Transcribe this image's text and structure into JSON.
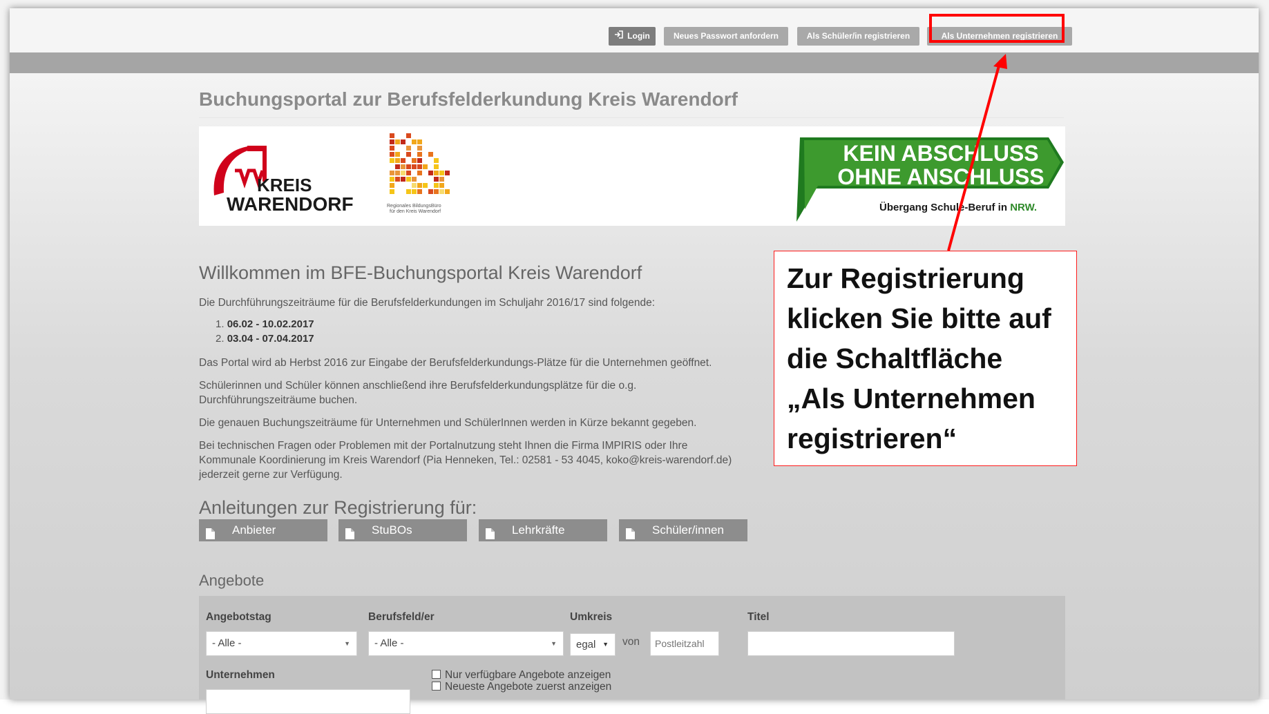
{
  "topbar": {
    "login_label": "Login",
    "password_label": "Neues Passwort anfordern",
    "student_register_label": "Als Schüler/in registrieren",
    "company_register_label": "Als Unternehmen registrieren"
  },
  "site_title": "Buchungsportal zur Berufsfelderkundung Kreis Warendorf",
  "banner": {
    "kreis_line1": "KREIS",
    "kreis_line2": "WARENDORF",
    "bb_line1": "Regionales BildungsBüro",
    "bb_line2": "für den Kreis Warendorf",
    "kaoa_line1": "KEIN ABSCHLUSS",
    "kaoa_line2": "OHNE ANSCHLUSS",
    "kaoa_sub_prefix": "Übergang Schule-Beruf in ",
    "kaoa_nrw": "NRW."
  },
  "welcome": {
    "heading": "Willkommen im BFE-Buchungsportal Kreis Warendorf",
    "intro": "Die Durchführungszeiträume für die Berufsfelderkundungen im Schuljahr 2016/17 sind folgende:",
    "periods": [
      {
        "num": "1.",
        "text": "06.02 - 10.02.2017"
      },
      {
        "num": "2.",
        "text": "03.04 - 07.04.2017"
      }
    ],
    "p1": "Das Portal wird ab Herbst 2016 zur Eingabe der Berufsfelderkundungs-Plätze für die Unternehmen geöffnet.",
    "p2a": "Schülerinnen und Schüler können anschließend ihre Berufsfelderkundungsplätze  für die o.g.",
    "p2b": "Durchführungszeiträume buchen.",
    "p3": "Die genauen Buchungszeiträume für Unternehmen und SchülerInnen werden in Kürze bekannt gegeben.",
    "p4a": "Bei technischen Fragen oder Problemen mit der Portalnutzung steht Ihnen die Firma IMPIRIS oder Ihre",
    "p4b": "Kommunale Koordinierung im Kreis Warendorf (Pia Henneken, Tel.: 02581 - 53 4045, koko@kreis-warendorf.de)",
    "p4c": "jederzeit gerne zur Verfügung."
  },
  "guides": {
    "heading": "Anleitungen zur Registrierung für:",
    "buttons": [
      "Anbieter",
      "StuBOs",
      "Lehrkräfte",
      "Schüler/innen"
    ]
  },
  "offers": {
    "heading": "Angebote",
    "angebotstag_label": "Angebotstag",
    "angebotstag_value": "- Alle -",
    "berufsfeld_label": "Berufsfeld/er",
    "berufsfeld_value": "- Alle -",
    "umkreis_label": "Umkreis",
    "umkreis_value": "egal",
    "von_label": "von",
    "plz_placeholder": "Postleitzahl",
    "titel_label": "Titel",
    "unternehmen_label": "Unternehmen",
    "check1": "Nur verfügbare Angebote anzeigen",
    "check2": "Neueste Angebote zuerst anzeigen"
  },
  "callout": {
    "line1": "Zur Registrierung",
    "line2": "klicken Sie bitte auf",
    "line3": "die Schaltfläche",
    "line4": "„Als Unternehmen",
    "line5": "registrieren“"
  },
  "colors": {
    "annotation_red": "#ff0000",
    "kaoa_green": "#2f8a2a",
    "kreis_red": "#d0021b"
  }
}
